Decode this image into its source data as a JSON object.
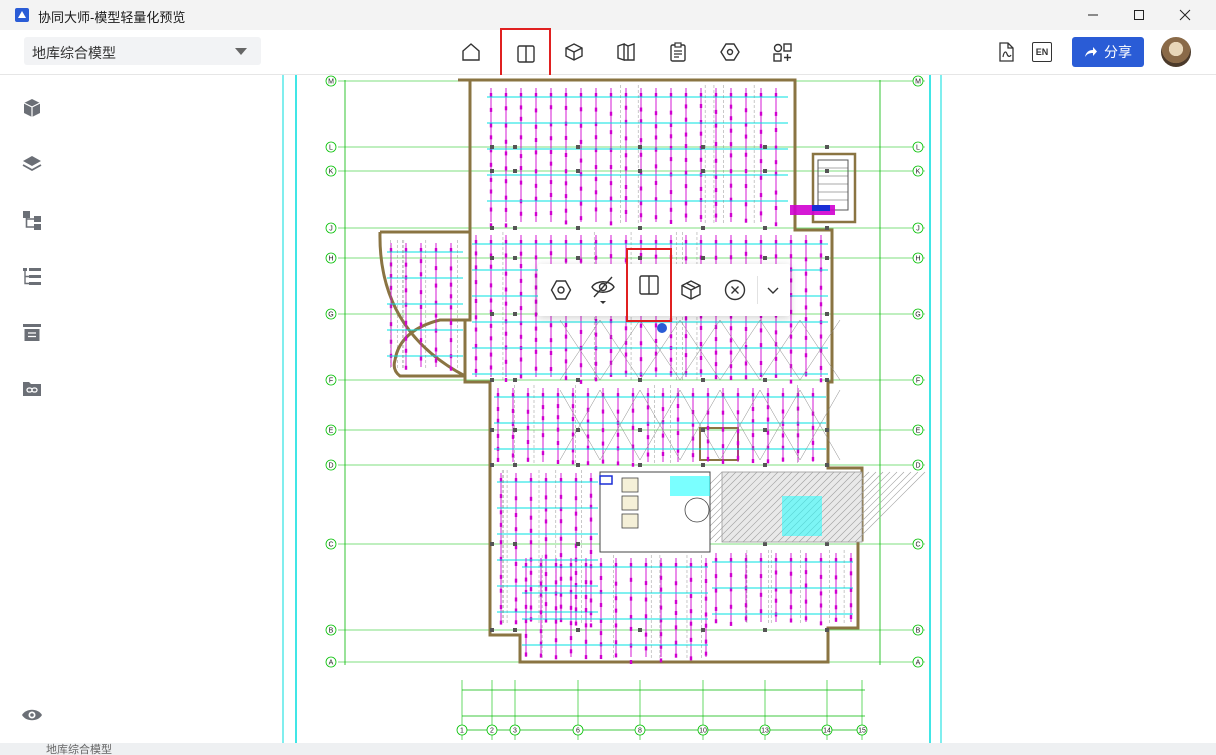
{
  "window": {
    "title": "协同大师-模型轻量化预览",
    "controls": [
      "minimize-icon",
      "maximize-icon",
      "close-icon"
    ]
  },
  "toolbar": {
    "model_select": "地库综合模型",
    "center_tools": [
      {
        "name": "home-icon",
        "highlighted": false
      },
      {
        "name": "split-view-icon",
        "highlighted": true
      },
      {
        "name": "model-cube-icon",
        "highlighted": false
      },
      {
        "name": "floor-plan-icon",
        "highlighted": false
      },
      {
        "name": "clipboard-icon",
        "highlighted": false
      },
      {
        "name": "hexagon-settings-icon",
        "highlighted": false
      },
      {
        "name": "components-icon",
        "highlighted": false
      }
    ],
    "right_tools": [
      "pdf-export-icon",
      "language-en-icon"
    ],
    "language_label": "EN",
    "share_label": "分享"
  },
  "sidebar": {
    "items": [
      "cube-icon",
      "layers-icon",
      "tree-structure-icon",
      "list-tree-icon",
      "archive-icon",
      "link-folder-icon"
    ],
    "bottom": "eye-icon"
  },
  "floating_toolbar": {
    "tools": [
      {
        "name": "hex-settings-icon",
        "highlighted": false
      },
      {
        "name": "hide-eye-icon",
        "highlighted": false
      },
      {
        "name": "split-view-icon",
        "highlighted": true
      },
      {
        "name": "box-section-icon",
        "highlighted": false
      },
      {
        "name": "close-circle-icon",
        "highlighted": false
      },
      {
        "name": "chevron-down-icon",
        "highlighted": false
      }
    ]
  },
  "drawing": {
    "grid_row_labels": [
      "M",
      "L",
      "K",
      "J",
      "H",
      "G",
      "F",
      "E",
      "D",
      "C",
      "B",
      "A"
    ],
    "grid_col_labels": [
      "1",
      "2",
      "3",
      "6",
      "8",
      "10",
      "13",
      "14",
      "15"
    ]
  },
  "bottom_strip": {
    "ghost_model_select": "地库综合模型"
  },
  "colors": {
    "accent": "#2a5cd6",
    "highlight": "#e02020",
    "cad_green": "#00c000",
    "cad_magenta": "#d000d0",
    "cad_cyan": "#00e0e0",
    "cad_wall": "#8a7442"
  }
}
